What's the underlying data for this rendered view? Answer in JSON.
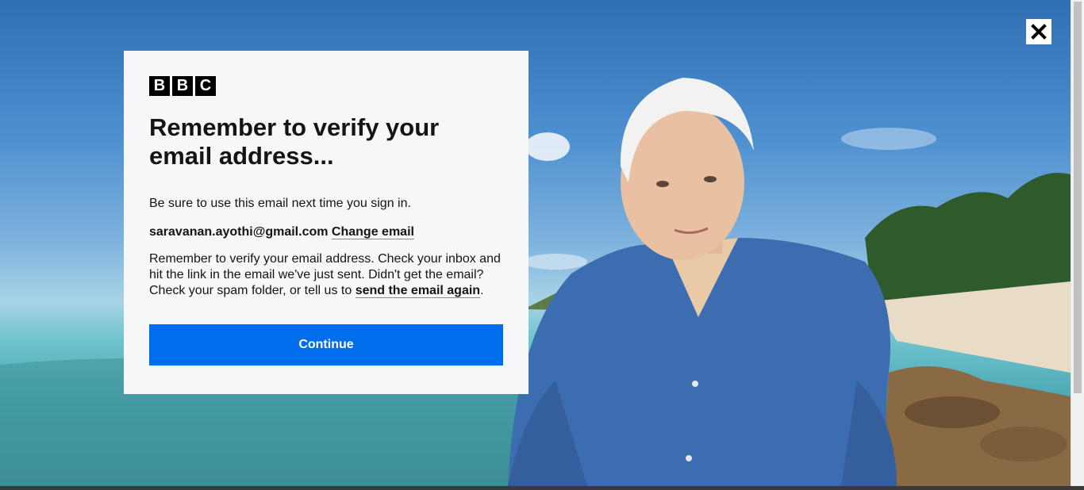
{
  "dialog": {
    "logo_letters": [
      "B",
      "B",
      "C"
    ],
    "title": "Remember to verify your email address...",
    "intro": "Be sure to use this email next time you sign in.",
    "email": "saravanan.ayothi@gmail.com",
    "change_email_label": "Change email",
    "body_text": "Remember to verify your email address. Check your inbox and hit the link in the email we've just sent. Didn't get the email? Check your spam folder, or tell us to",
    "resend_label": "send the email again",
    "body_end": ".",
    "continue_label": "Continue"
  },
  "close_button": {
    "icon": "close-icon"
  },
  "colors": {
    "accent": "#006ded",
    "card_background": "#f6f7f8",
    "text": "#141414"
  }
}
